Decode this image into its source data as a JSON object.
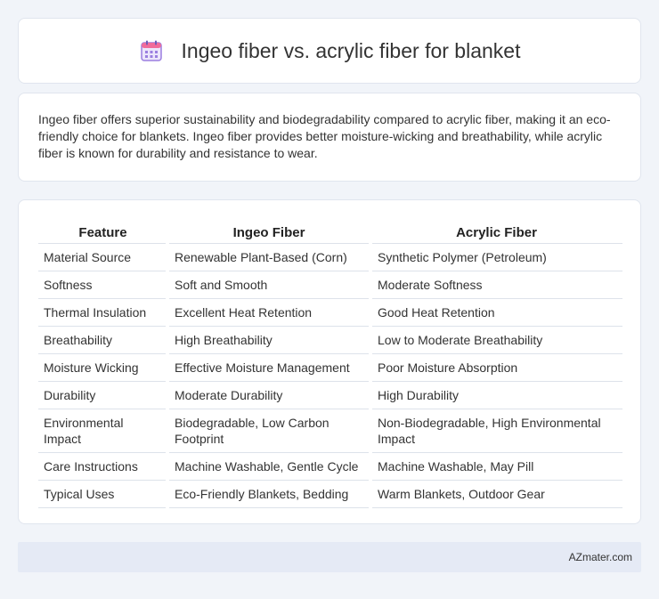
{
  "header": {
    "title": "Ingeo fiber vs. acrylic fiber for blanket",
    "icon": "calendar-icon"
  },
  "intro": {
    "text": "Ingeo fiber offers superior sustainability and biodegradability compared to acrylic fiber, making it an eco-friendly choice for blankets. Ingeo fiber provides better moisture-wicking and breathability, while acrylic fiber is known for durability and resistance to wear."
  },
  "table": {
    "columns": [
      "Feature",
      "Ingeo Fiber",
      "Acrylic Fiber"
    ],
    "rows": [
      [
        "Material Source",
        "Renewable Plant-Based (Corn)",
        "Synthetic Polymer (Petroleum)"
      ],
      [
        "Softness",
        "Soft and Smooth",
        "Moderate Softness"
      ],
      [
        "Thermal Insulation",
        "Excellent Heat Retention",
        "Good Heat Retention"
      ],
      [
        "Breathability",
        "High Breathability",
        "Low to Moderate Breathability"
      ],
      [
        "Moisture Wicking",
        "Effective Moisture Management",
        "Poor Moisture Absorption"
      ],
      [
        "Durability",
        "Moderate Durability",
        "High Durability"
      ],
      [
        "Environmental Impact",
        "Biodegradable, Low Carbon Footprint",
        "Non-Biodegradable, High Environmental Impact"
      ],
      [
        "Care Instructions",
        "Machine Washable, Gentle Cycle",
        "Machine Washable, May Pill"
      ],
      [
        "Typical Uses",
        "Eco-Friendly Blankets, Bedding",
        "Warm Blankets, Outdoor Gear"
      ]
    ]
  },
  "footer": {
    "text": "AZmater.com"
  },
  "colors": {
    "background": "#f1f4f9",
    "card": "#ffffff",
    "footer": "#e5eaf5",
    "icon_purple": "#9b7fe0",
    "icon_pink": "#f06c9b"
  }
}
